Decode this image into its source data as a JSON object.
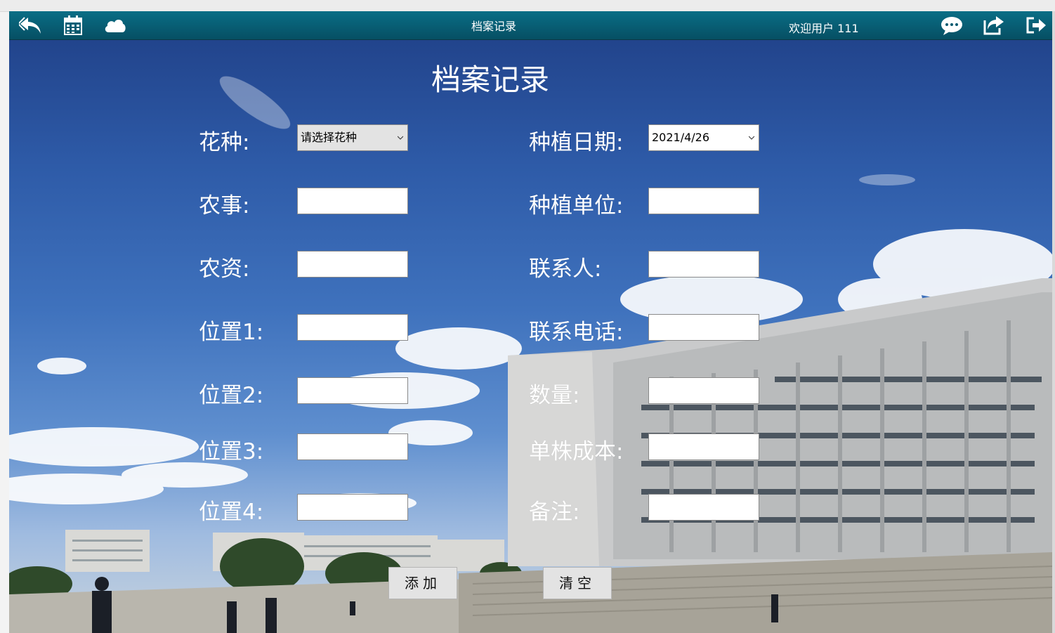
{
  "toolbar": {
    "title": "档案记录",
    "welcome": "欢迎用户 111",
    "icons": [
      "reply-icon",
      "calendar-icon",
      "cloud-icon",
      "comment-icon",
      "share-icon",
      "logout-icon"
    ]
  },
  "page_title": "档案记录",
  "form": {
    "flower_label": "花种:",
    "flower_value": "请选择花种",
    "farming_label": "农事:",
    "farming_value": "",
    "supplies_label": "农资:",
    "supplies_value": "",
    "pos1_label": "位置1:",
    "pos1_value": "",
    "pos2_label": "位置2:",
    "pos2_value": "",
    "pos3_label": "位置3:",
    "pos3_value": "",
    "pos4_label": "位置4:",
    "pos4_value": "",
    "date_label": "种植日期:",
    "date_value": "2021/4/26",
    "unit_label": "种植单位:",
    "unit_value": "",
    "contact_label": "联系人:",
    "contact_value": "",
    "phone_label": "联系电话:",
    "phone_value": "",
    "qty_label": "数量:",
    "qty_value": "",
    "cost_label": "单株成本:",
    "cost_value": "",
    "note_label": "备注:",
    "note_value": ""
  },
  "buttons": {
    "add": "添加",
    "clear": "清空"
  },
  "colors": {
    "toolbar": "#075a70",
    "sky": "#3f72bd"
  }
}
